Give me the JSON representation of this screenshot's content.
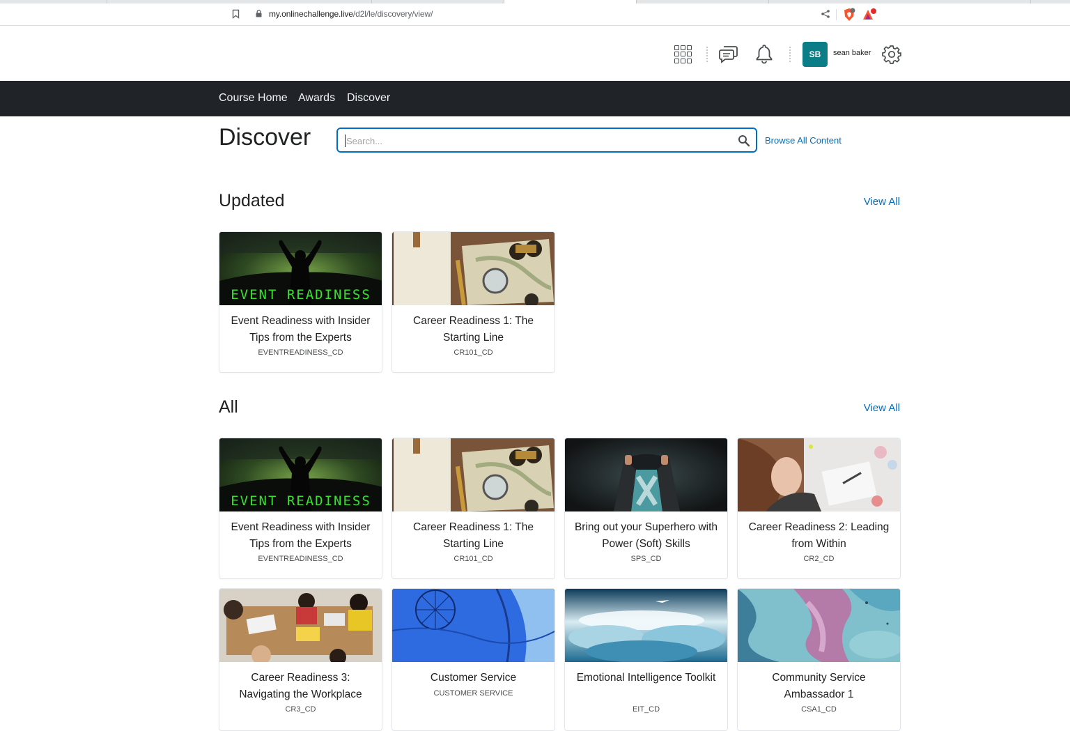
{
  "browser": {
    "url_host": "my.onlinechallenge.live",
    "url_path": "/d2l/le/discovery/view/"
  },
  "minibar": {
    "avatar_initials": "SB",
    "user_name": "sean baker"
  },
  "nav": {
    "items": [
      "Course Home",
      "Awards",
      "Discover"
    ]
  },
  "page": {
    "title": "Discover",
    "search_placeholder": "Search...",
    "browse_all": "Browse All Content"
  },
  "sections": {
    "updated": {
      "title": "Updated",
      "view_all": "View All",
      "cards": [
        {
          "title": "Event Readiness with Insider Tips from the Experts",
          "code": "EVENTREADINESS_CD",
          "image": "event-readiness"
        },
        {
          "title": "Career Readiness 1: The Starting Line",
          "code": "CR101_CD",
          "image": "career-map"
        }
      ]
    },
    "all": {
      "title": "All",
      "view_all": "View All",
      "cards": [
        {
          "title": "Event Readiness with Insider Tips from the Experts",
          "code": "EVENTREADINESS_CD",
          "image": "event-readiness"
        },
        {
          "title": "Career Readiness 1: The Starting Line",
          "code": "CR101_CD",
          "image": "career-map"
        },
        {
          "title": "Bring out your Superhero with Power (Soft) Skills",
          "code": "SPS_CD",
          "image": "superhero"
        },
        {
          "title": "Career Readiness 2: Leading from Within",
          "code": "CR2_CD",
          "image": "woman-writing"
        },
        {
          "title": "Career Readiness 3: Navigating the Workplace",
          "code": "CR3_CD",
          "image": "team-table"
        },
        {
          "title": "Customer Service",
          "code": "CUSTOMER SERVICE",
          "image": "balloon"
        },
        {
          "title": "Emotional Intelligence Toolkit",
          "code": "EIT_CD",
          "image": "clouds"
        },
        {
          "title": "Community Service Ambassador 1",
          "code": "CSA1_CD",
          "image": "ink"
        }
      ]
    }
  },
  "thumb_text": {
    "event_readiness": "EVENT READINESS"
  },
  "colors": {
    "navbar": "#202328",
    "link": "#006fbf",
    "avatar": "#0b7d86"
  }
}
